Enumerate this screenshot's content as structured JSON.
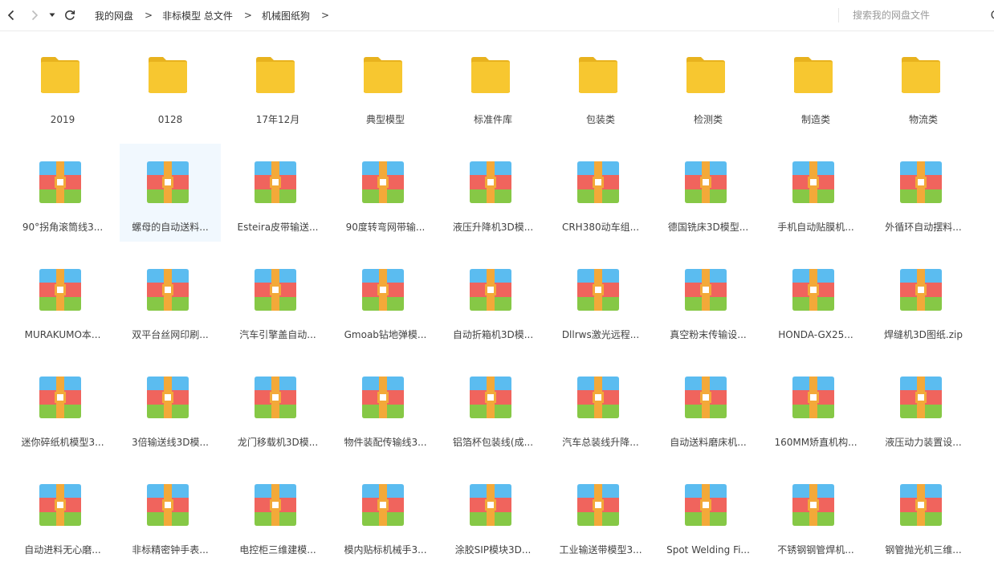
{
  "toolbar": {
    "back_icon": "chevron-left-icon",
    "forward_icon": "chevron-right-icon",
    "history_icon": "caret-down-icon",
    "refresh_icon": "refresh-icon",
    "breadcrumb": [
      "我的网盘",
      "非标模型 总文件",
      "机械图纸狗"
    ],
    "separator": ">",
    "search_placeholder": "搜索我的网盘文件"
  },
  "colors": {
    "folder": "#f7c730",
    "folder_tab": "#e8b21e",
    "zip_blue": "#5bbcf0",
    "zip_red": "#f0645d",
    "zip_green": "#86c846",
    "zip_strap": "#f3a939",
    "selection": "#f1f8fe"
  },
  "files": [
    {
      "name": "2019",
      "type": "folder"
    },
    {
      "name": "0128",
      "type": "folder"
    },
    {
      "name": "17年12月",
      "type": "folder"
    },
    {
      "name": "典型模型",
      "type": "folder"
    },
    {
      "name": "标准件库",
      "type": "folder"
    },
    {
      "name": "包装类",
      "type": "folder"
    },
    {
      "name": "检测类",
      "type": "folder"
    },
    {
      "name": "制造类",
      "type": "folder"
    },
    {
      "name": "物流类",
      "type": "folder"
    },
    {
      "name": "90°拐角滚筒线3...",
      "type": "zip"
    },
    {
      "name": "螺母的自动送料...",
      "type": "zip",
      "selected": true
    },
    {
      "name": "Esteira皮带输送...",
      "type": "zip"
    },
    {
      "name": "90度转弯网带输...",
      "type": "zip"
    },
    {
      "name": "液压升降机3D模...",
      "type": "zip"
    },
    {
      "name": "CRH380动车组...",
      "type": "zip"
    },
    {
      "name": "德国铣床3D模型...",
      "type": "zip"
    },
    {
      "name": "手机自动贴膜机...",
      "type": "zip"
    },
    {
      "name": "外循环自动摆料...",
      "type": "zip"
    },
    {
      "name": "MURAKUMO本...",
      "type": "zip"
    },
    {
      "name": "双平台丝网印刷...",
      "type": "zip"
    },
    {
      "name": "汽车引擎盖自动...",
      "type": "zip"
    },
    {
      "name": "Gmoab钻地弹模...",
      "type": "zip"
    },
    {
      "name": "自动折箱机3D模...",
      "type": "zip"
    },
    {
      "name": "Dllrws激光远程...",
      "type": "zip"
    },
    {
      "name": "真空粉末传输设...",
      "type": "zip"
    },
    {
      "name": "HONDA-GX25...",
      "type": "zip"
    },
    {
      "name": "焊缝机3D图纸.zip",
      "type": "zip"
    },
    {
      "name": "迷你碎纸机模型3...",
      "type": "zip"
    },
    {
      "name": "3倍输送线3D模...",
      "type": "zip"
    },
    {
      "name": "龙门移载机3D模...",
      "type": "zip"
    },
    {
      "name": "物件装配传输线3...",
      "type": "zip"
    },
    {
      "name": "铝箔杯包装线(成...",
      "type": "zip"
    },
    {
      "name": "汽车总装线升降...",
      "type": "zip"
    },
    {
      "name": "自动送料磨床机...",
      "type": "zip"
    },
    {
      "name": "160MM矫直机构...",
      "type": "zip"
    },
    {
      "name": "液压动力装置设...",
      "type": "zip"
    },
    {
      "name": "自动进料无心磨...",
      "type": "zip"
    },
    {
      "name": "非标精密钟手表...",
      "type": "zip"
    },
    {
      "name": "电控柜三维建模...",
      "type": "zip"
    },
    {
      "name": "模内贴标机械手3...",
      "type": "zip"
    },
    {
      "name": "涂胶SIP模块3D...",
      "type": "zip"
    },
    {
      "name": "工业输送带模型3...",
      "type": "zip"
    },
    {
      "name": "Spot Welding Fi...",
      "type": "zip"
    },
    {
      "name": "不锈钢钢管焊机...",
      "type": "zip"
    },
    {
      "name": "钢管抛光机三维...",
      "type": "zip"
    }
  ]
}
